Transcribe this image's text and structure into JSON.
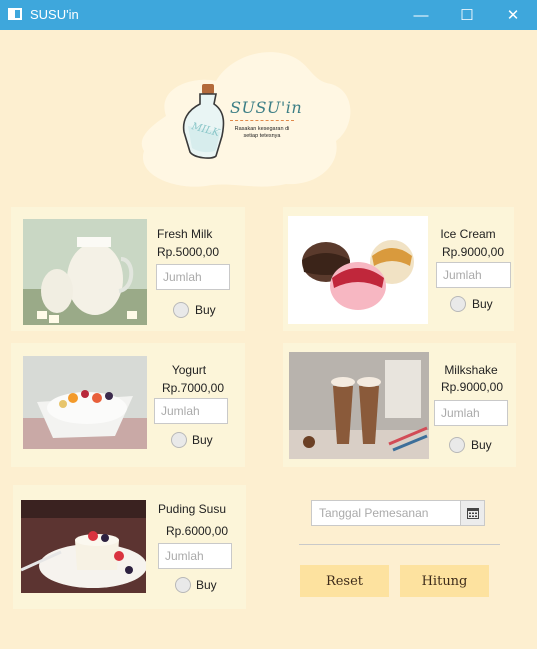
{
  "window": {
    "title": "SUSU'in",
    "minimize_glyph": "—",
    "maximize_glyph": "☐",
    "close_glyph": "✕"
  },
  "logo": {
    "wordmark": "SUSU'in",
    "tagline": "Rasakan kesegaran di setiap tetesnya",
    "bottle_label": "MILK"
  },
  "products": [
    {
      "id": "fresh-milk",
      "name": "Fresh Milk",
      "price": "Rp.5000,00",
      "quantity_placeholder": "Jumlah",
      "buy_label": "Buy"
    },
    {
      "id": "ice-cream",
      "name": "Ice Cream",
      "price": "Rp.9000,00",
      "quantity_placeholder": "Jumlah",
      "buy_label": "Buy"
    },
    {
      "id": "yogurt",
      "name": "Yogurt",
      "price": "Rp.7000,00",
      "quantity_placeholder": "Jumlah",
      "buy_label": "Buy"
    },
    {
      "id": "milkshake",
      "name": "Milkshake",
      "price": "Rp.9000,00",
      "quantity_placeholder": "Jumlah",
      "buy_label": "Buy"
    },
    {
      "id": "puding-susu",
      "name": "Puding Susu",
      "price": "Rp.6000,00",
      "quantity_placeholder": "Jumlah",
      "buy_label": "Buy"
    }
  ],
  "order": {
    "date_placeholder": "Tanggal Pemesanan",
    "reset_label": "Reset",
    "calculate_label": "Hitung"
  },
  "colors": {
    "background": "#fdefd0",
    "card": "#fcf5d9",
    "titlebar": "#3ea7dc",
    "button": "#fde29f",
    "logo_text": "#3d7f86"
  }
}
